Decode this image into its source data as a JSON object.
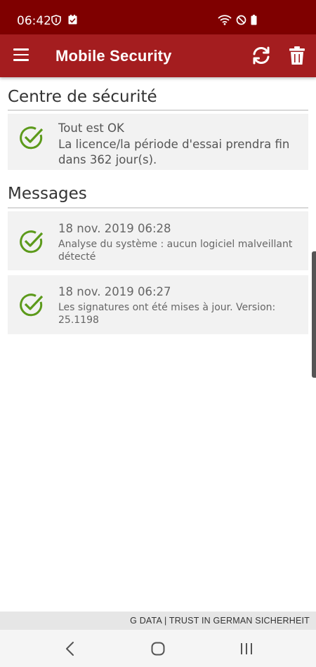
{
  "status_bar": {
    "time": "06:42",
    "icons": [
      "shield-icon",
      "checkbox-icon",
      "wifi-icon",
      "do-not-disturb-icon",
      "battery-icon"
    ]
  },
  "app_bar": {
    "menu_icon": "menu-icon",
    "title": "Mobile Security",
    "refresh_icon": "refresh-icon",
    "trash_icon": "trash-icon"
  },
  "security_centre": {
    "heading": "Centre de sécurité",
    "status_card": {
      "icon": "check-circle-icon",
      "title": "Tout est OK",
      "text": "La licence/la période d'essai prendra fin dans 362 jour(s)."
    }
  },
  "messages": {
    "heading": "Messages",
    "items": [
      {
        "icon": "check-circle-icon",
        "date": "18 nov. 2019 06:28",
        "text": "Analyse du système : aucun logiciel malveillant détecté"
      },
      {
        "icon": "check-circle-icon",
        "date": "18 nov. 2019 06:27",
        "text": "Les signatures ont été mises à jour. Version: 25.1198"
      }
    ]
  },
  "footer": {
    "text": "G DATA | TRUST IN GERMAN SICHERHEIT"
  },
  "nav_bar": {
    "icons": [
      "back-icon",
      "home-icon",
      "recents-icon"
    ]
  },
  "colors": {
    "status_bar": "#7f0000",
    "app_bar": "#a41d1f",
    "check": "#5c9a1b",
    "card_bg": "#f2f2f2"
  }
}
